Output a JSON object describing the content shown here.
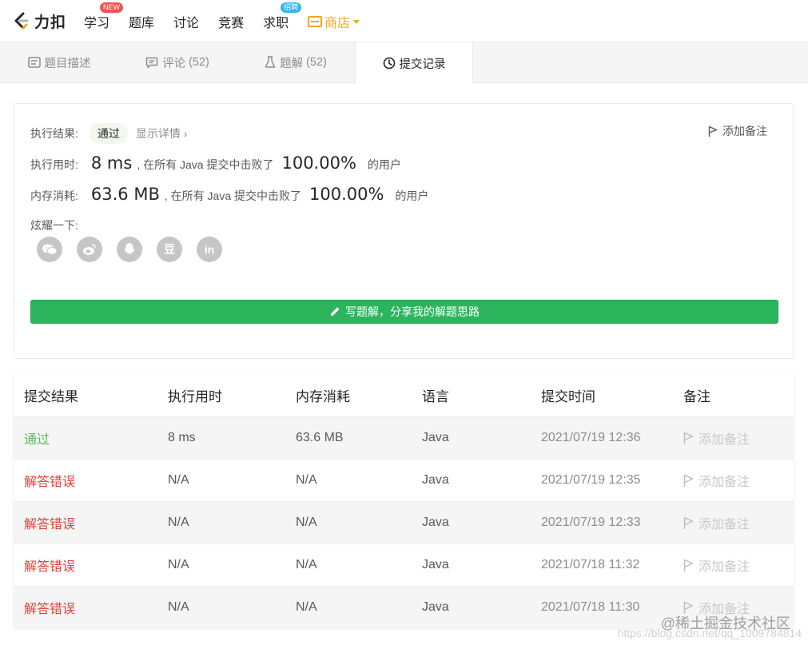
{
  "nav": {
    "logo_text": "力扣",
    "items": [
      {
        "label": "学习",
        "badge": "NEW"
      },
      {
        "label": "题库"
      },
      {
        "label": "讨论"
      },
      {
        "label": "竞赛"
      },
      {
        "label": "求职",
        "badge": "招聘"
      }
    ],
    "store_label": "商店"
  },
  "tabs": [
    {
      "label": "题目描述"
    },
    {
      "label": "评论",
      "count": "(52)"
    },
    {
      "label": "题解",
      "count": "(52)"
    },
    {
      "label": "提交记录",
      "active": true
    }
  ],
  "result": {
    "result_label": "执行结果:",
    "status": "通过",
    "detail_link": "显示详情 ›",
    "add_note": "添加备注",
    "time_label": "执行用时:",
    "time_value": "8 ms",
    "time_text": ", 在所有 Java 提交中击败了",
    "time_pct": "100.00%",
    "time_suffix": "的用户",
    "mem_label": "内存消耗:",
    "mem_value": "63.6 MB",
    "mem_text": ", 在所有 Java 提交中击败了",
    "mem_pct": "100.00%",
    "mem_suffix": "的用户",
    "show_label": "炫耀一下:",
    "share_icons": [
      "wechat-icon",
      "weibo-icon",
      "qq-icon",
      "douban-icon",
      "linkedin-icon"
    ],
    "share_glyphs": [
      "",
      "",
      "",
      "豆",
      "in"
    ],
    "write_button": "写题解，分享我的解题思路"
  },
  "table": {
    "headers": [
      "提交结果",
      "执行用时",
      "内存消耗",
      "语言",
      "提交时间",
      "备注"
    ],
    "rows": [
      {
        "status": "通过",
        "pass": true,
        "time": "8 ms",
        "memory": "63.6 MB",
        "lang": "Java",
        "submitted": "2021/07/19 12:36",
        "note": "添加备注"
      },
      {
        "status": "解答错误",
        "pass": false,
        "time": "N/A",
        "memory": "N/A",
        "lang": "Java",
        "submitted": "2021/07/19 12:35",
        "note": "添加备注"
      },
      {
        "status": "解答错误",
        "pass": false,
        "time": "N/A",
        "memory": "N/A",
        "lang": "Java",
        "submitted": "2021/07/19 12:33",
        "note": "添加备注"
      },
      {
        "status": "解答错误",
        "pass": false,
        "time": "N/A",
        "memory": "N/A",
        "lang": "Java",
        "submitted": "2021/07/18 11:32",
        "note": "添加备注"
      },
      {
        "status": "解答错误",
        "pass": false,
        "time": "N/A",
        "memory": "N/A",
        "lang": "Java",
        "submitted": "2021/07/18 11:30",
        "note": "添加备注"
      }
    ]
  },
  "watermark": {
    "line1": "@稀土掘金技术社区",
    "line2": "https://blog.csdn.net/qq_1009784814"
  },
  "colors": {
    "pass": "#5cb85c",
    "fail": "#e0413b",
    "primary_button": "#2db55d",
    "store": "#f5a623"
  }
}
